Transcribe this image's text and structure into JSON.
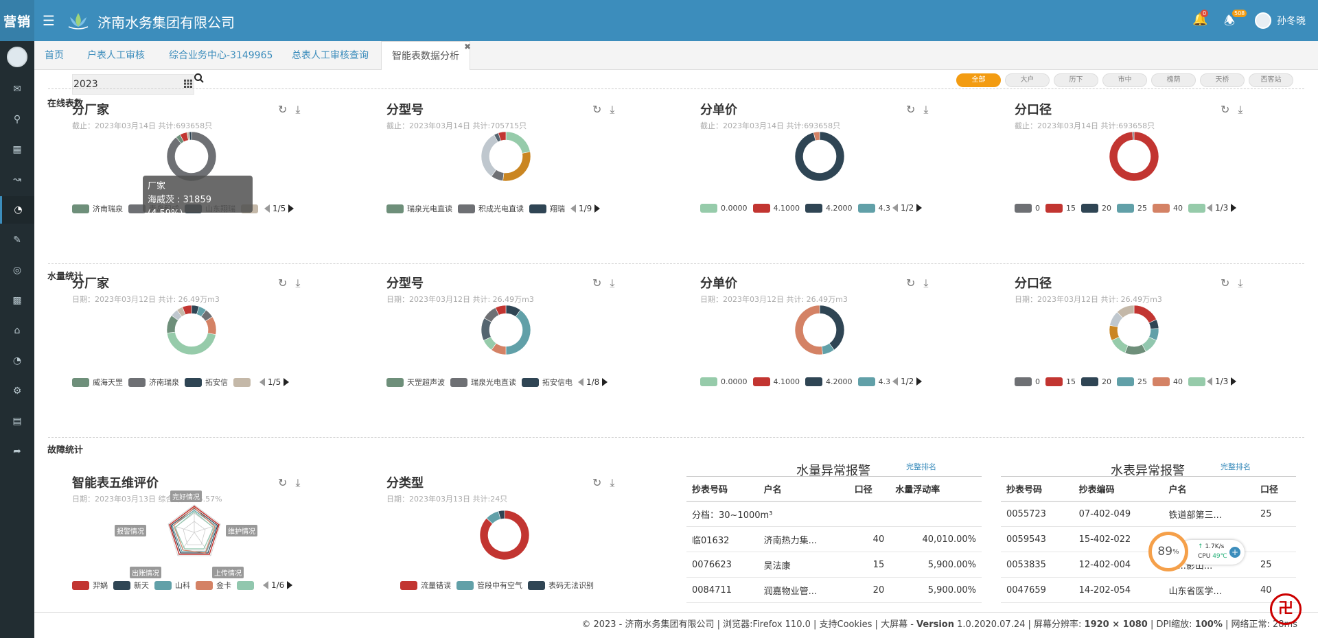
{
  "header": {
    "brand": "营销",
    "company": "济南水务集团有限公司",
    "notif_count": "0",
    "alert_count": "508",
    "username": "孙冬晓"
  },
  "tabs": [
    {
      "label": "首页"
    },
    {
      "label": "户表人工审核"
    },
    {
      "label": "综合业务中心-3149965"
    },
    {
      "label": "总表人工审核查询"
    },
    {
      "label": "智能表数据分析"
    }
  ],
  "filter": {
    "year": "2023"
  },
  "districts": [
    "全部",
    "大户",
    "历下",
    "市中",
    "槐荫",
    "天桥",
    "西客站"
  ],
  "sections": {
    "online": "在线表数",
    "water": "水量统计",
    "fault": "故障统计"
  },
  "online_cards": [
    {
      "title": "分厂家",
      "sub": "截止：2023年03月14日 共计:693658只",
      "legend": [
        "济南瑞泉",
        "青岛积成",
        "山东翔瑞",
        ""
      ],
      "page": "1/5",
      "slices": [
        {
          "v": 88,
          "c": "#6e7074"
        },
        {
          "v": 3,
          "c": "#6e8f7a"
        },
        {
          "v": 4.59,
          "c": "#c23531"
        },
        {
          "v": 1.5,
          "c": "#c4b8a8"
        },
        {
          "v": 1.5,
          "c": "#2f4554"
        }
      ]
    },
    {
      "title": "分型号",
      "sub": "截止：2023年03月14日 共计:705715只",
      "legend": [
        "瑞泉光电直读",
        "积成光电直读",
        "翔瑞"
      ],
      "page": "1/9",
      "slices": [
        {
          "v": 22,
          "c": "#96cbaa"
        },
        {
          "v": 30,
          "c": "#ca8622"
        },
        {
          "v": 8,
          "c": "#6e7074"
        },
        {
          "v": 32,
          "c": "#bfc7ce"
        },
        {
          "v": 3,
          "c": "#546570"
        },
        {
          "v": 5,
          "c": "#c23531"
        }
      ]
    },
    {
      "title": "分单价",
      "sub": "截止：2023年03月14日 共计:693658只",
      "legend": [
        "0.0000",
        "4.1000",
        "4.2000",
        "4.3"
      ],
      "page": "1/2",
      "slices": [
        {
          "v": 96,
          "c": "#2f4554"
        },
        {
          "v": 4,
          "c": "#d48265"
        }
      ]
    },
    {
      "title": "分口径",
      "sub": "截止：2023年03月14日 共计:693658只",
      "legend": [
        "0",
        "15",
        "20",
        "25",
        "40",
        ""
      ],
      "page": "1/3",
      "slices": [
        {
          "v": 99,
          "c": "#c23531"
        },
        {
          "v": 1,
          "c": "#6e7074"
        }
      ]
    }
  ],
  "water_cards": [
    {
      "title": "分厂家",
      "sub": "日期：2023年03月12日 共计: 26.49万m3",
      "legend": [
        "威海天罡",
        "济南瑞泉",
        "拓安信",
        ""
      ],
      "page": "1/5",
      "slices": [
        {
          "v": 5,
          "c": "#2f4554"
        },
        {
          "v": 5,
          "c": "#61a0a8"
        },
        {
          "v": 6,
          "c": "#6e7074"
        },
        {
          "v": 12,
          "c": "#d48265"
        },
        {
          "v": 45,
          "c": "#96cbaa"
        },
        {
          "v": 12,
          "c": "#6e8f7a"
        },
        {
          "v": 5,
          "c": "#bfc7ce"
        },
        {
          "v": 4,
          "c": "#c4b8a8"
        },
        {
          "v": 6,
          "c": "#c23531"
        }
      ]
    },
    {
      "title": "分型号",
      "sub": "日期：2023年03月12日 共计: 26.49万m3",
      "legend": [
        "天罡超声波",
        "瑞泉光电直读",
        "拓安信电"
      ],
      "page": "1/8",
      "slices": [
        {
          "v": 10,
          "c": "#2f4554"
        },
        {
          "v": 40,
          "c": "#61a0a8"
        },
        {
          "v": 10,
          "c": "#d48265"
        },
        {
          "v": 8,
          "c": "#96cbaa"
        },
        {
          "v": 15,
          "c": "#546570"
        },
        {
          "v": 10,
          "c": "#6e7074"
        },
        {
          "v": 7,
          "c": "#c23531"
        }
      ]
    },
    {
      "title": "分单价",
      "sub": "日期：2023年03月12日 共计: 26.49万m3",
      "legend": [
        "0.0000",
        "4.1000",
        "4.2000",
        "4.3"
      ],
      "page": "1/2",
      "slices": [
        {
          "v": 40,
          "c": "#2f4554"
        },
        {
          "v": 8,
          "c": "#61a0a8"
        },
        {
          "v": 52,
          "c": "#d48265"
        }
      ]
    },
    {
      "title": "分口径",
      "sub": "日期：2023年03月12日 共计: 26.49万m3",
      "legend": [
        "0",
        "15",
        "20",
        "25",
        "40",
        ""
      ],
      "page": "1/3",
      "slices": [
        {
          "v": 18,
          "c": "#c23531"
        },
        {
          "v": 6,
          "c": "#2f4554"
        },
        {
          "v": 8,
          "c": "#61a0a8"
        },
        {
          "v": 10,
          "c": "#91c7ae"
        },
        {
          "v": 14,
          "c": "#6e8f7a"
        },
        {
          "v": 12,
          "c": "#96cbaa"
        },
        {
          "v": 10,
          "c": "#ca8622"
        },
        {
          "v": 10,
          "c": "#bfc7ce"
        },
        {
          "v": 12,
          "c": "#c4b8a8"
        }
      ]
    }
  ],
  "radar_card": {
    "title": "智能表五维评价",
    "sub": "日期：2023年03月13日 综合评分: 95.57%",
    "labels": [
      "完好情况",
      "维护情况",
      "上传情况",
      "出账情况",
      "报警情况"
    ],
    "legend": [
      "羿娲",
      "新天",
      "山科",
      "金卡",
      ""
    ],
    "page": "1/6"
  },
  "type_card": {
    "title": "分类型",
    "sub": "日期：2023年03月13日 共计:24只",
    "legend": [
      "流量错误",
      "管段中有空气",
      "表码无法识别"
    ],
    "slices": [
      {
        "v": 87,
        "c": "#c23531"
      },
      {
        "v": 9,
        "c": "#61a0a8"
      },
      {
        "v": 4,
        "c": "#2f4554"
      }
    ]
  },
  "tooltip": {
    "name": "厂家",
    "value": "海威茨 : 31859 (4.59%)"
  },
  "table1": {
    "title": "水量异常报警",
    "link": "完整排名",
    "headers": [
      "抄表号码",
      "户名",
      "口径",
      "水量浮动率"
    ],
    "group": "分档：30~1000m³",
    "rows": [
      [
        "临01632",
        "济南热力集...",
        "40",
        "40,010.00%"
      ],
      [
        "0076623",
        "吴法康",
        "15",
        "5,900.00%"
      ],
      [
        "0084711",
        "润嘉物业管...",
        "20",
        "5,900.00%"
      ]
    ]
  },
  "table2": {
    "title": "水表异常报警",
    "link": "完整排名",
    "headers": [
      "抄表号码",
      "抄表编码",
      "户名",
      "口径"
    ],
    "rows": [
      [
        "0055723",
        "07-402-049",
        "铁道部第三...",
        "25"
      ],
      [
        "0059543",
        "15-402-022",
        "",
        ""
      ],
      [
        "0053835",
        "12-402-004",
        "天...影山...",
        "25"
      ],
      [
        "0047659",
        "14-202-054",
        "山东省医学...",
        "40"
      ]
    ]
  },
  "cpu": {
    "percent": "89",
    "net": "1.7K/s",
    "cpu_label": "CPU",
    "temp": "49℃"
  },
  "footer": {
    "text1": "© 2023 - 济南水务集团有限公司 | 浏览器:Firefox 110.0 | 支持Cookies | 大屏幕 - ",
    "version_label": "Version",
    "version": " 1.0.2020.07.24 | 屏幕分辨率: ",
    "resolution": "1920 × 1080",
    "dpi_label": " | DPI缩放: ",
    "dpi": "100%",
    "net": " | 网络正常: 28ms"
  },
  "colors": {
    "primary": "#3c8dbc",
    "sidebar": "#222d32",
    "active_pill": "#f39c12"
  }
}
